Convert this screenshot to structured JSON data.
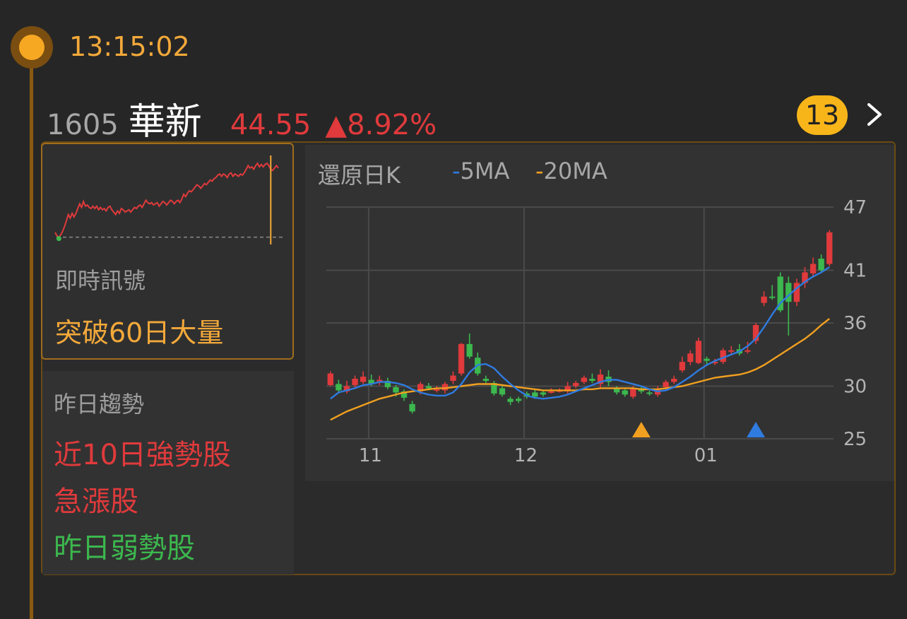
{
  "timeline": {
    "time": "13:15:02"
  },
  "stock": {
    "code": "1605",
    "name": "華新",
    "price": "44.55",
    "change": "▲8.92%",
    "count_badge": "13"
  },
  "signal": {
    "label": "即時訊號",
    "value": "突破60日大量"
  },
  "trend": {
    "label": "昨日趨勢",
    "items": [
      {
        "text": "近10日強勢股",
        "color": "#e03a3c"
      },
      {
        "text": "急漲股",
        "color": "#e03a3c"
      },
      {
        "text": "昨日弱勢股",
        "color": "#3cb84e"
      }
    ]
  },
  "kline": {
    "title": "還原日K",
    "legend": [
      {
        "label": "5MA",
        "color": "#2f7be0"
      },
      {
        "label": "20MA",
        "color": "#f0a020"
      }
    ]
  },
  "colors": {
    "up": "#e03a3c",
    "down": "#3cb84e",
    "accent": "#f3a93a",
    "ma5": "#2f7be0",
    "ma20": "#f0a020"
  },
  "chart_data": {
    "type": "candlestick",
    "y_ticks": [
      47,
      41,
      36,
      30,
      25
    ],
    "ylim": [
      25,
      47
    ],
    "x_ticks": [
      {
        "label": "11",
        "index": 5
      },
      {
        "label": "12",
        "index": 24
      },
      {
        "label": "01",
        "index": 46
      }
    ],
    "markers": [
      {
        "index": 38,
        "color": "#f0a020",
        "icon": "triangle-up"
      },
      {
        "index": 52,
        "color": "#2f7be0",
        "icon": "triangle-up"
      }
    ],
    "candles": [
      [
        30.1,
        31.2,
        31.4,
        30.0
      ],
      [
        30.2,
        29.6,
        30.6,
        29.4
      ],
      [
        29.5,
        30.0,
        30.5,
        29.3
      ],
      [
        30.1,
        30.7,
        31.0,
        29.9
      ],
      [
        30.4,
        30.9,
        31.4,
        30.2
      ],
      [
        30.6,
        30.2,
        31.1,
        30.0
      ],
      [
        30.5,
        30.6,
        31.0,
        30.1
      ],
      [
        30.5,
        29.9,
        30.8,
        29.7
      ],
      [
        29.9,
        29.4,
        30.1,
        29.0
      ],
      [
        29.5,
        28.9,
        29.7,
        28.6
      ],
      [
        28.3,
        27.6,
        28.6,
        27.4
      ],
      [
        29.5,
        30.2,
        30.4,
        29.2
      ],
      [
        30.0,
        29.8,
        30.3,
        29.6
      ],
      [
        29.6,
        29.7,
        30.0,
        29.4
      ],
      [
        29.6,
        30.2,
        30.4,
        29.3
      ],
      [
        30.5,
        31.0,
        31.4,
        30.2
      ],
      [
        31.2,
        34.0,
        34.1,
        31.0
      ],
      [
        34.0,
        32.8,
        35.0,
        32.6
      ],
      [
        32.7,
        31.2,
        33.2,
        31.0
      ],
      [
        30.7,
        30.5,
        31.0,
        30.3
      ],
      [
        30.3,
        29.3,
        30.5,
        29.1
      ],
      [
        29.8,
        29.2,
        30.0,
        29.0
      ],
      [
        28.8,
        28.5,
        29.0,
        28.2
      ],
      [
        28.8,
        28.6,
        29.0,
        28.4
      ],
      [
        29.3,
        29.0,
        29.5,
        28.8
      ],
      [
        29.4,
        29.0,
        29.7,
        28.8
      ],
      [
        29.4,
        29.2,
        29.6,
        29.0
      ],
      [
        29.5,
        29.5,
        29.8,
        29.3
      ],
      [
        29.6,
        29.6,
        29.8,
        29.4
      ],
      [
        29.5,
        30.0,
        30.4,
        29.3
      ],
      [
        30.0,
        30.3,
        30.5,
        29.8
      ],
      [
        30.4,
        30.8,
        31.0,
        30.2
      ],
      [
        30.7,
        30.5,
        31.2,
        30.3
      ],
      [
        30.2,
        31.1,
        31.6,
        29.8
      ],
      [
        30.9,
        30.4,
        31.5,
        30.0
      ],
      [
        29.8,
        29.4,
        30.0,
        29.2
      ],
      [
        29.6,
        29.2,
        29.8,
        29.0
      ],
      [
        29.0,
        29.8,
        30.0,
        28.8
      ],
      [
        29.8,
        29.5,
        30.0,
        29.3
      ],
      [
        29.4,
        29.3,
        29.6,
        29.1
      ],
      [
        29.2,
        29.7,
        30.0,
        29.0
      ],
      [
        29.9,
        30.4,
        30.6,
        29.7
      ],
      [
        30.4,
        30.7,
        31.0,
        30.2
      ],
      [
        31.5,
        32.3,
        32.8,
        31.3
      ],
      [
        32.3,
        33.1,
        33.4,
        32.0
      ],
      [
        32.2,
        34.3,
        34.6,
        32.1
      ],
      [
        32.6,
        32.4,
        32.8,
        32.0
      ],
      [
        32.2,
        32.3,
        32.6,
        32.0
      ],
      [
        32.3,
        33.4,
        33.6,
        32.1
      ],
      [
        33.4,
        33.4,
        33.8,
        32.9
      ],
      [
        33.5,
        33.1,
        34.0,
        32.9
      ],
      [
        33.4,
        33.4,
        34.2,
        33.1
      ],
      [
        34.3,
        35.8,
        36.0,
        34.0
      ],
      [
        37.9,
        38.5,
        39.0,
        37.6
      ],
      [
        38.5,
        38.4,
        39.6,
        38.2
      ],
      [
        40.4,
        37.2,
        40.8,
        37.0
      ],
      [
        39.8,
        38.0,
        40.4,
        34.8
      ],
      [
        38.0,
        39.8,
        40.2,
        37.6
      ],
      [
        39.8,
        40.8,
        41.3,
        39.3
      ],
      [
        40.7,
        41.6,
        42.2,
        40.3
      ],
      [
        42.1,
        41.0,
        42.5,
        40.8
      ],
      [
        41.6,
        44.6,
        44.8,
        41.4
      ]
    ],
    "ma5": [
      28.8,
      29.4,
      29.6,
      29.8,
      30.1,
      30.2,
      30.4,
      30.4,
      30.3,
      30.1,
      29.7,
      29.4,
      29.2,
      29.1,
      29.1,
      29.4,
      30.2,
      31.3,
      32.0,
      32.1,
      31.7,
      30.9,
      30.2,
      29.6,
      29.1,
      28.9,
      28.8,
      28.9,
      29.0,
      29.2,
      29.5,
      29.8,
      30.1,
      30.4,
      30.6,
      30.6,
      30.4,
      30.2,
      30.0,
      29.7,
      29.5,
      29.6,
      29.9,
      30.4,
      30.9,
      31.5,
      32.0,
      32.4,
      32.7,
      33.0,
      33.3,
      33.8,
      34.5,
      35.6,
      36.8,
      37.9,
      38.6,
      39.3,
      39.9,
      40.4,
      40.8,
      41.3
    ],
    "ma20": [
      26.8,
      27.2,
      27.6,
      27.9,
      28.2,
      28.5,
      28.8,
      29.0,
      29.2,
      29.4,
      29.5,
      29.6,
      29.7,
      29.8,
      29.8,
      29.9,
      30.0,
      30.1,
      30.2,
      30.2,
      30.2,
      30.1,
      30.0,
      29.9,
      29.8,
      29.7,
      29.6,
      29.6,
      29.6,
      29.6,
      29.6,
      29.7,
      29.7,
      29.8,
      29.8,
      29.8,
      29.8,
      29.8,
      29.7,
      29.7,
      29.7,
      29.8,
      29.9,
      30.0,
      30.2,
      30.4,
      30.6,
      30.8,
      30.9,
      31.0,
      31.1,
      31.3,
      31.6,
      32.0,
      32.5,
      33.0,
      33.5,
      34.0,
      34.5,
      35.1,
      35.8,
      36.4
    ]
  },
  "mini_chart": {
    "type": "line",
    "prev_close": 40.9,
    "values": [
      41.3,
      41.0,
      40.9,
      41.1,
      41.4,
      41.8,
      42.3,
      42.8,
      42.5,
      42.9,
      42.6,
      42.9,
      43.3,
      43.7,
      43.4,
      43.9,
      43.5,
      43.6,
      43.4,
      43.3,
      43.5,
      43.3,
      43.5,
      43.2,
      43.4,
      43.2,
      43.3,
      43.1,
      43.4,
      43.5,
      43.2,
      43.0,
      42.8,
      43.1,
      42.9,
      43.3,
      43.2,
      43.0,
      43.1,
      43.2,
      43.0,
      43.2,
      43.4,
      43.3,
      43.5,
      43.6,
      43.4,
      43.7,
      44.0,
      43.8,
      43.7,
      43.8,
      43.6,
      43.7,
      43.8,
      43.5,
      43.7,
      43.9,
      43.8,
      43.6,
      43.8,
      44.0,
      43.9,
      43.7,
      43.9,
      44.0,
      43.8,
      44.1,
      44.5,
      44.3,
      44.6,
      44.8,
      44.7,
      44.9,
      45.1,
      45.3,
      45.2,
      45.0,
      45.2,
      45.4,
      45.3,
      45.5,
      45.7,
      45.6,
      45.8,
      45.9,
      46.1,
      46.2,
      46.0,
      46.2,
      46.1,
      45.9,
      46.2,
      46.3,
      46.0,
      46.2,
      46.1,
      46.0,
      46.2,
      46.1,
      46.3,
      46.6,
      46.9,
      46.7,
      46.8,
      46.6,
      46.9,
      47.1,
      46.8,
      47.0,
      46.8,
      47.0,
      47.1,
      46.9,
      46.6,
      46.5,
      46.7,
      46.9,
      46.7
    ],
    "marker_index": 114
  }
}
